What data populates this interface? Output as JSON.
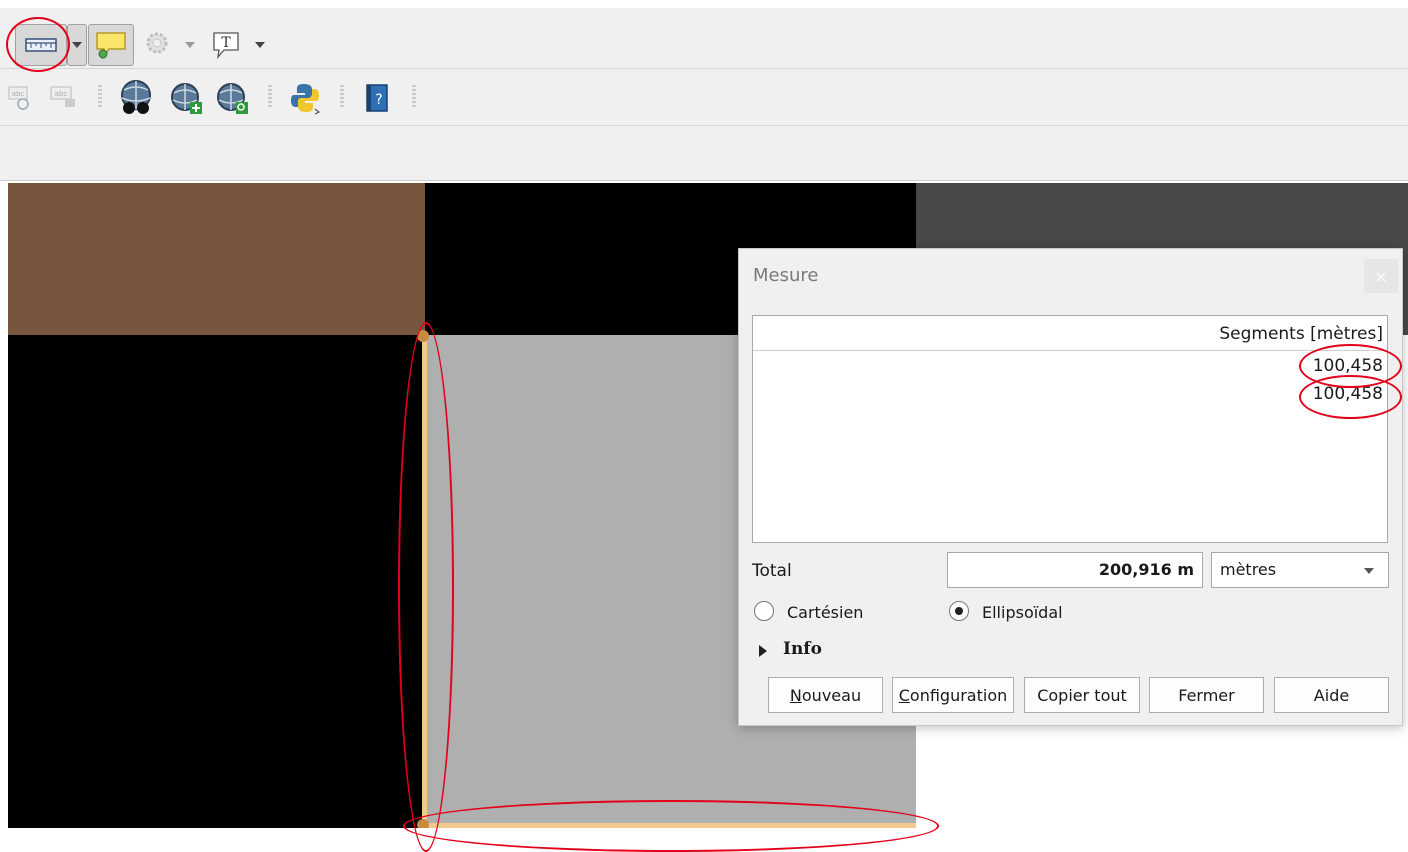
{
  "toolbar1": {
    "icons": [
      "ruler-icon",
      "dropdown-caret",
      "map-tips-icon",
      "identify-gear-icon",
      "dropdown-caret",
      "text-annotation-icon",
      "dropdown-caret"
    ]
  },
  "toolbar2": {
    "icons": [
      "label-rotate-icon",
      "label-edit-icon",
      "globe-binoculars-icon",
      "globe-add-icon",
      "globe-search-icon",
      "python-icon",
      "help-book-icon"
    ]
  },
  "dialog": {
    "title": "Mesure",
    "close_glyph": "×",
    "table_header": "Segments [mètres]",
    "segments": [
      "100,458",
      "100,458"
    ],
    "total_label": "Total",
    "total_value": "200,916 m",
    "unit_selected": "mètres",
    "radio_cartesian": "Cartésien",
    "radio_ellipsoidal": "Ellipsoïdal",
    "ellipsoidal_selected": true,
    "info_label": "Info",
    "buttons": {
      "new_prefix": "N",
      "new_rest": "ouveau",
      "config_prefix": "C",
      "config_rest": "onfiguration",
      "copy": "Copier tout",
      "close": "Fermer",
      "help": "Aide"
    }
  },
  "colors": {
    "brown_tile": "#77563d",
    "black_tile": "#000000",
    "dark_gray_tile": "#484848",
    "light_gray_tile": "#afafaf",
    "measure_line": "#f3c88c",
    "annotation": "#e3001b"
  }
}
